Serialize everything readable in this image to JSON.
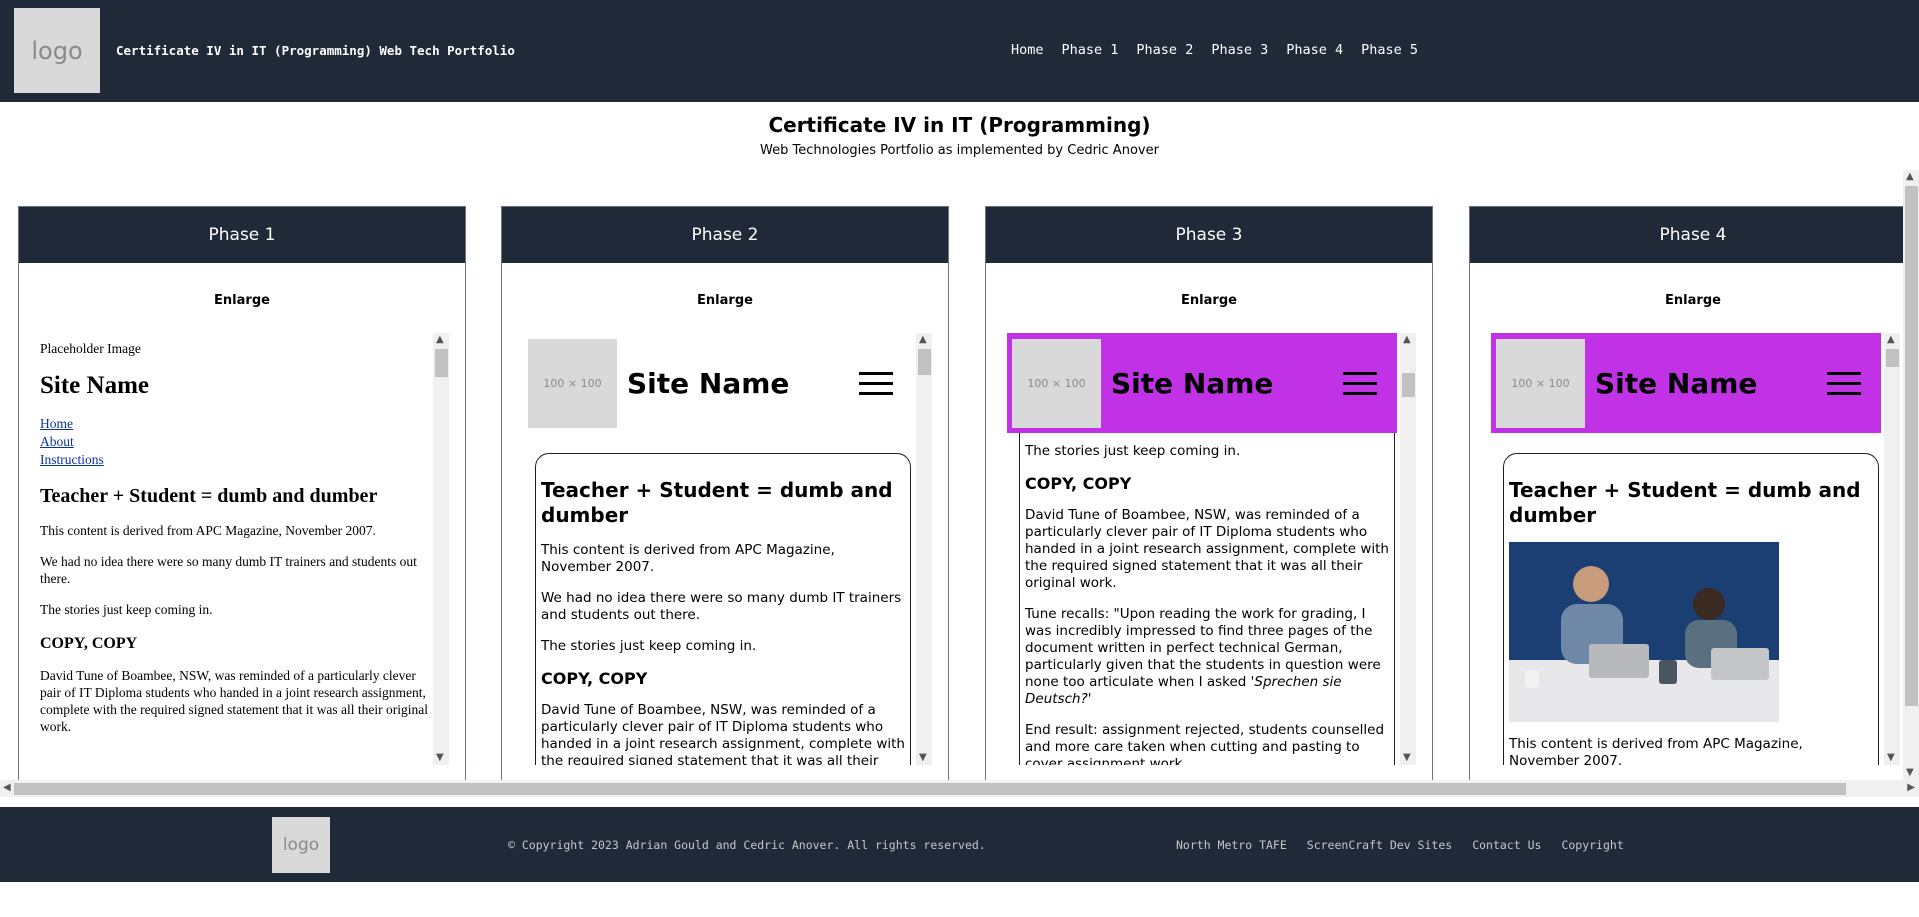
{
  "header": {
    "logo": "logo",
    "title": "Certificate IV in IT (Programming) Web Tech Portfolio",
    "nav": [
      "Home",
      "Phase 1",
      "Phase 2",
      "Phase 3",
      "Phase 4",
      "Phase 5"
    ]
  },
  "hero": {
    "title": "Certificate IV in IT (Programming)",
    "subtitle": "Web Technologies Portfolio as implemented by Cedric Anover"
  },
  "cards": [
    {
      "title": "Phase 1",
      "enlarge": "Enlarge"
    },
    {
      "title": "Phase 2",
      "enlarge": "Enlarge"
    },
    {
      "title": "Phase 3",
      "enlarge": "Enlarge"
    },
    {
      "title": "Phase 4",
      "enlarge": "Enlarge"
    }
  ],
  "preview": {
    "placeholder_image": "Placeholder Image",
    "placeholder_size": "100 × 100",
    "site_name": "Site Name",
    "links": [
      "Home",
      "About",
      "Instructions"
    ],
    "article_title": "Teacher + Student = dumb and dumber",
    "p1": "This content is derived from APC Magazine, November 2007.",
    "p2": "We had no idea there were so many dumb IT trainers and students out there.",
    "p3": "The stories just keep coming in.",
    "copy_heading": "COPY, COPY",
    "p4": "David Tune of Boambee, NSW, was reminded of a particularly clever pair of IT Diploma students who handed in a joint research assignment, complete with the required signed statement that it was all their original work.",
    "p5_lead": "Tune recalls: \"Upon reading the work for grading, I was incredibly impressed to find three pages of the document written in perfect technical German, particularly given that the students in question were none too articulate when I asked ",
    "p5_quote": "'Sprechen sie Deutsch?'",
    "p6": "End result: assignment rejected, students counselled and more care taken when cutting and pasting to cover assignment work."
  },
  "footer": {
    "logo": "logo",
    "copyright": "© Copyright 2023 Adrian Gould and Cedric Anover. All rights reserved.",
    "links": [
      "North Metro TAFE",
      "ScreenCraft Dev Sites",
      "Contact Us",
      "Copyright"
    ]
  },
  "colors": {
    "header_bg": "#1f2937",
    "accent_purple": "#c132e6",
    "link": "#0b34a3"
  }
}
